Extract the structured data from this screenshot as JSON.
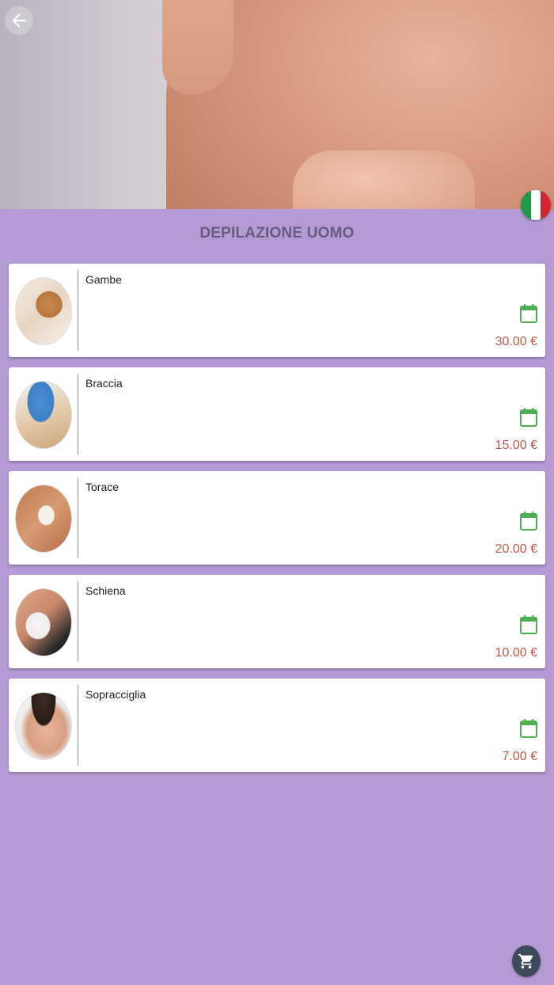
{
  "header": {
    "back_icon": "arrow-left-icon",
    "language_icon": "italy-flag-icon"
  },
  "title": "DEPILAZIONE UOMO",
  "services": [
    {
      "name": "Gambe",
      "price": "30.00 €"
    },
    {
      "name": "Braccia",
      "price": "15.00 €"
    },
    {
      "name": "Torace",
      "price": "20.00 €"
    },
    {
      "name": "Schiena",
      "price": "10.00 €"
    },
    {
      "name": "Sopracciglia",
      "price": "7.00 €"
    }
  ],
  "colors": {
    "background": "#b59bd6",
    "title": "#6a5a7d",
    "price": "#c2574a",
    "calendar": "#4caf50",
    "cart_button": "#3e4a5c"
  },
  "cart_icon": "cart-icon"
}
